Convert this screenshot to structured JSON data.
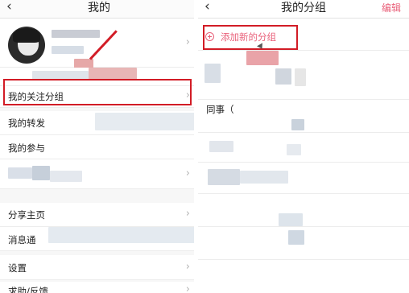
{
  "left": {
    "title": "我的",
    "back_icon": "chevron-left-icon",
    "menu": [
      {
        "label": "我的关注分组"
      },
      {
        "label": "我的转发"
      },
      {
        "label": "我的参与"
      },
      {
        "label": "分享主页"
      },
      {
        "label": "消息通"
      },
      {
        "label": "设置"
      },
      {
        "label": "求助/反馈"
      }
    ]
  },
  "right": {
    "title": "我的分组",
    "edit_label": "编辑",
    "add_group_label": "添加新的分组",
    "groups": [
      {
        "label": "同事（"
      }
    ]
  },
  "colors": {
    "accent_pink": "#e9617a",
    "highlight_red": "#d21c26",
    "chevron_gray": "#b5b5b5"
  }
}
